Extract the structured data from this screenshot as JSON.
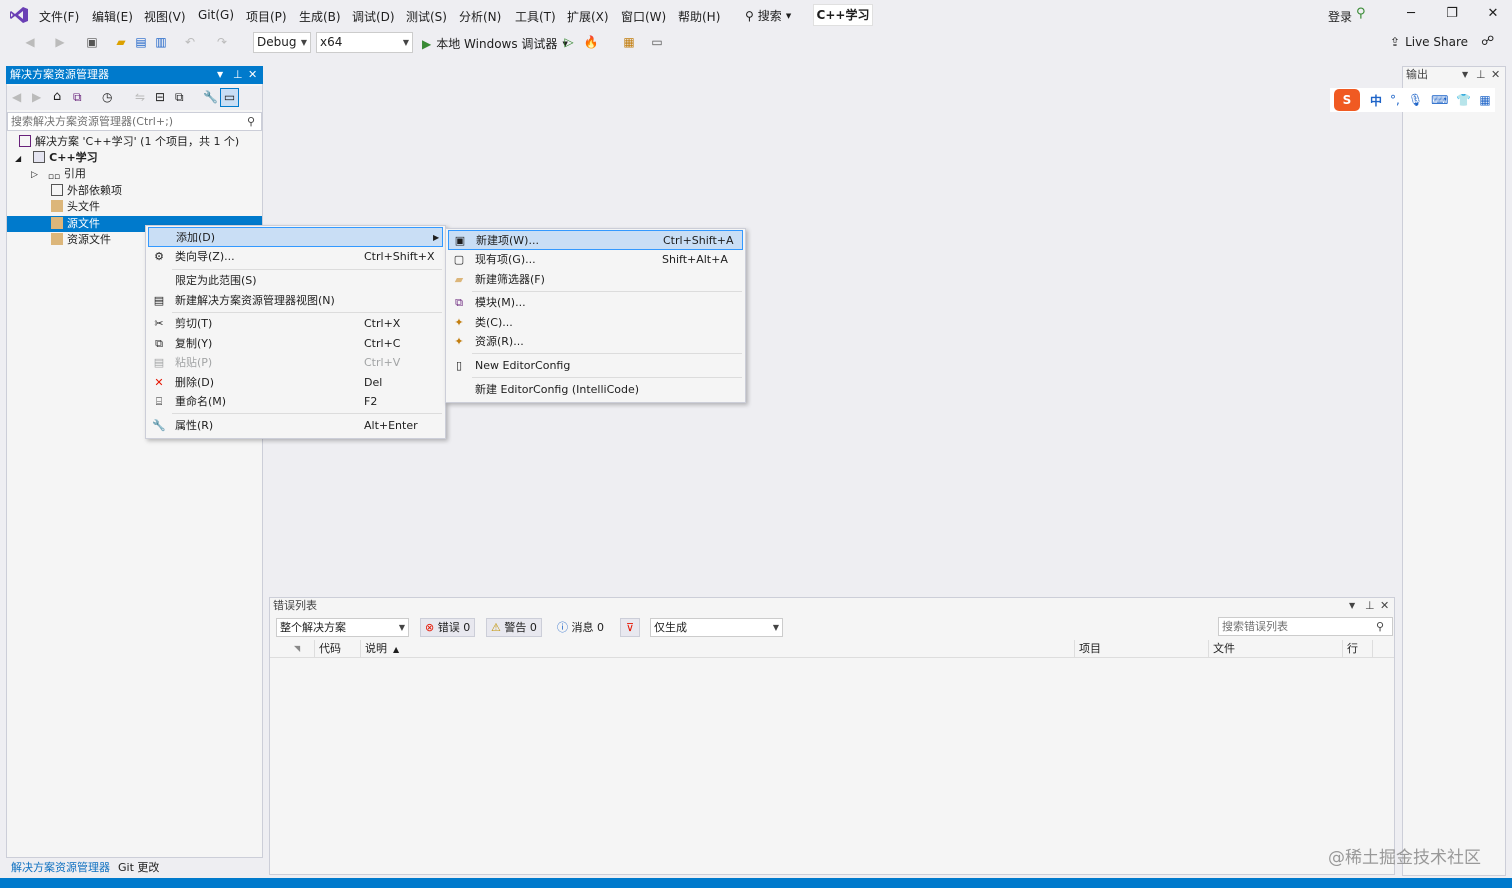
{
  "menubar": {
    "items": [
      "文件(F)",
      "编辑(E)",
      "视图(V)",
      "Git(G)",
      "项目(P)",
      "生成(B)",
      "调试(D)",
      "测试(S)",
      "分析(N)",
      "工具(T)",
      "扩展(X)",
      "窗口(W)",
      "帮助(H)"
    ],
    "search_label": "搜索",
    "project_name": "C++学习",
    "login_label": "登录",
    "live_share_label": "Live Share"
  },
  "toolbar": {
    "config": "Debug",
    "platform": "x64",
    "run_label": "本地 Windows 调试器"
  },
  "solution_explorer": {
    "title": "解决方案资源管理器",
    "search_placeholder": "搜索解决方案资源管理器(Ctrl+;)",
    "tree": [
      "解决方案 'C++学习' (1 个项目，共 1 个)",
      "C++学习",
      "引用",
      "外部依赖项",
      "头文件",
      "源文件",
      "资源文件"
    ],
    "bottom_tabs": [
      "解决方案资源管理器",
      "Git 更改"
    ]
  },
  "context_menu": {
    "items": [
      {
        "label": "添加(D)",
        "shortcut": ""
      },
      {
        "label": "类向导(Z)...",
        "shortcut": "Ctrl+Shift+X"
      },
      {
        "label": "限定为此范围(S)",
        "shortcut": ""
      },
      {
        "label": "新建解决方案资源管理器视图(N)",
        "shortcut": ""
      },
      {
        "label": "剪切(T)",
        "shortcut": "Ctrl+X"
      },
      {
        "label": "复制(Y)",
        "shortcut": "Ctrl+C"
      },
      {
        "label": "粘贴(P)",
        "shortcut": "Ctrl+V"
      },
      {
        "label": "删除(D)",
        "shortcut": "Del"
      },
      {
        "label": "重命名(M)",
        "shortcut": "F2"
      },
      {
        "label": "属性(R)",
        "shortcut": "Alt+Enter"
      }
    ]
  },
  "submenu": {
    "items": [
      {
        "label": "新建项(W)...",
        "shortcut": "Ctrl+Shift+A"
      },
      {
        "label": "现有项(G)...",
        "shortcut": "Shift+Alt+A"
      },
      {
        "label": "新建筛选器(F)",
        "shortcut": ""
      },
      {
        "label": "模块(M)...",
        "shortcut": ""
      },
      {
        "label": "类(C)...",
        "shortcut": ""
      },
      {
        "label": "资源(R)...",
        "shortcut": ""
      },
      {
        "label": "New EditorConfig",
        "shortcut": ""
      },
      {
        "label": "新建 EditorConfig (IntelliCode)",
        "shortcut": ""
      }
    ]
  },
  "error_list": {
    "title": "错误列表",
    "scope": "整个解决方案",
    "errors": "错误 0",
    "warnings": "警告 0",
    "messages": "消息 0",
    "build_filter": "仅生成",
    "search_placeholder": "搜索错误列表",
    "columns": [
      "代码",
      "说明",
      "项目",
      "文件",
      "行"
    ]
  },
  "output": {
    "title": "输出",
    "ime_label": "中"
  },
  "watermark": "@稀土掘金技术社区",
  "colors": {
    "accent": "#007acc",
    "highlight": "#c9def5",
    "error": "#e51400",
    "warning": "#f2c744"
  }
}
